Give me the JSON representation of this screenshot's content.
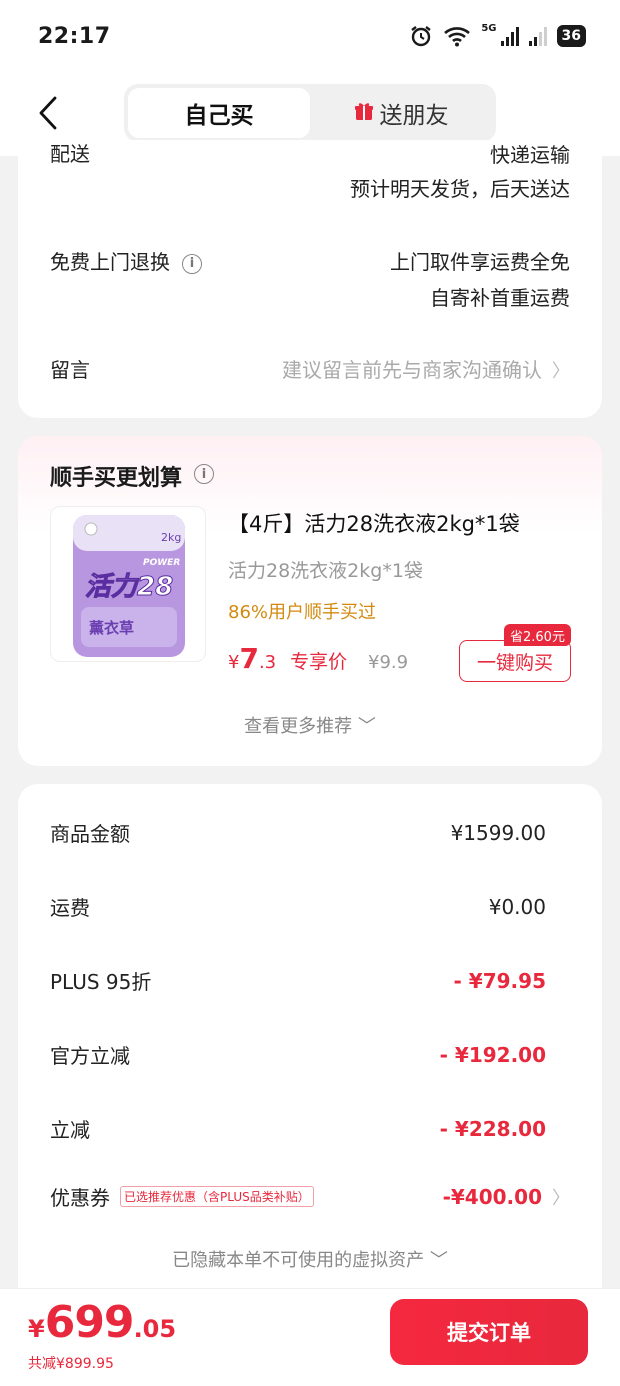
{
  "status_bar": {
    "time": "22:17",
    "signal_label": "5G",
    "battery": "36"
  },
  "header": {
    "tabs": [
      {
        "label": "自己买",
        "active": true
      },
      {
        "label": "送朋友",
        "active": false
      }
    ],
    "gift_icon": "gift-icon"
  },
  "delivery": {
    "label": "配送",
    "method": "快递运输",
    "eta": "预计明天发货，后天送达"
  },
  "return_service": {
    "label": "免费上门退换",
    "line1": "上门取件享运费全免",
    "line2": "自寄补首重运费"
  },
  "message": {
    "label": "留言",
    "placeholder": "建议留言前先与商家沟通确认"
  },
  "addon": {
    "title": "顺手买更划算",
    "product": {
      "title": "【4斤】活力28洗衣液2kg*1袋",
      "subtitle": "活力28洗衣液2kg*1袋",
      "rate": "86%用户顺手买过",
      "price_symbol": "¥",
      "price_int": "7",
      "price_dec": ".3",
      "price_tag": "专享价",
      "orig_price": "¥9.9",
      "save_badge": "省2.60元",
      "buy_label": "一键购买",
      "img_brand": "活力28",
      "img_power": "POWER",
      "img_weight": "2kg",
      "img_scent": "薰衣草"
    },
    "more_label": "查看更多推荐"
  },
  "fees": {
    "rows": [
      {
        "label": "商品金额",
        "value": "¥1599.00",
        "red": false
      },
      {
        "label": "运费",
        "value": "¥0.00",
        "red": false
      },
      {
        "label": "PLUS 95折",
        "value": "- ¥79.95",
        "red": true
      },
      {
        "label": "官方立减",
        "value": "- ¥192.00",
        "red": true
      },
      {
        "label": "立减",
        "value": "- ¥228.00",
        "red": true
      }
    ],
    "coupon": {
      "label": "优惠券",
      "tag": "已选推荐优惠（含PLUS品类补贴）",
      "value": "-¥400.00"
    },
    "hidden_assets": "已隐藏本单不可使用的虚拟资产"
  },
  "bottom": {
    "yen": "¥",
    "total_int": "699",
    "total_dec": ".05",
    "saved": "共减¥899.95",
    "submit_label": "提交订单"
  },
  "colors": {
    "accent": "#e8283c",
    "orange": "#d48a10"
  }
}
